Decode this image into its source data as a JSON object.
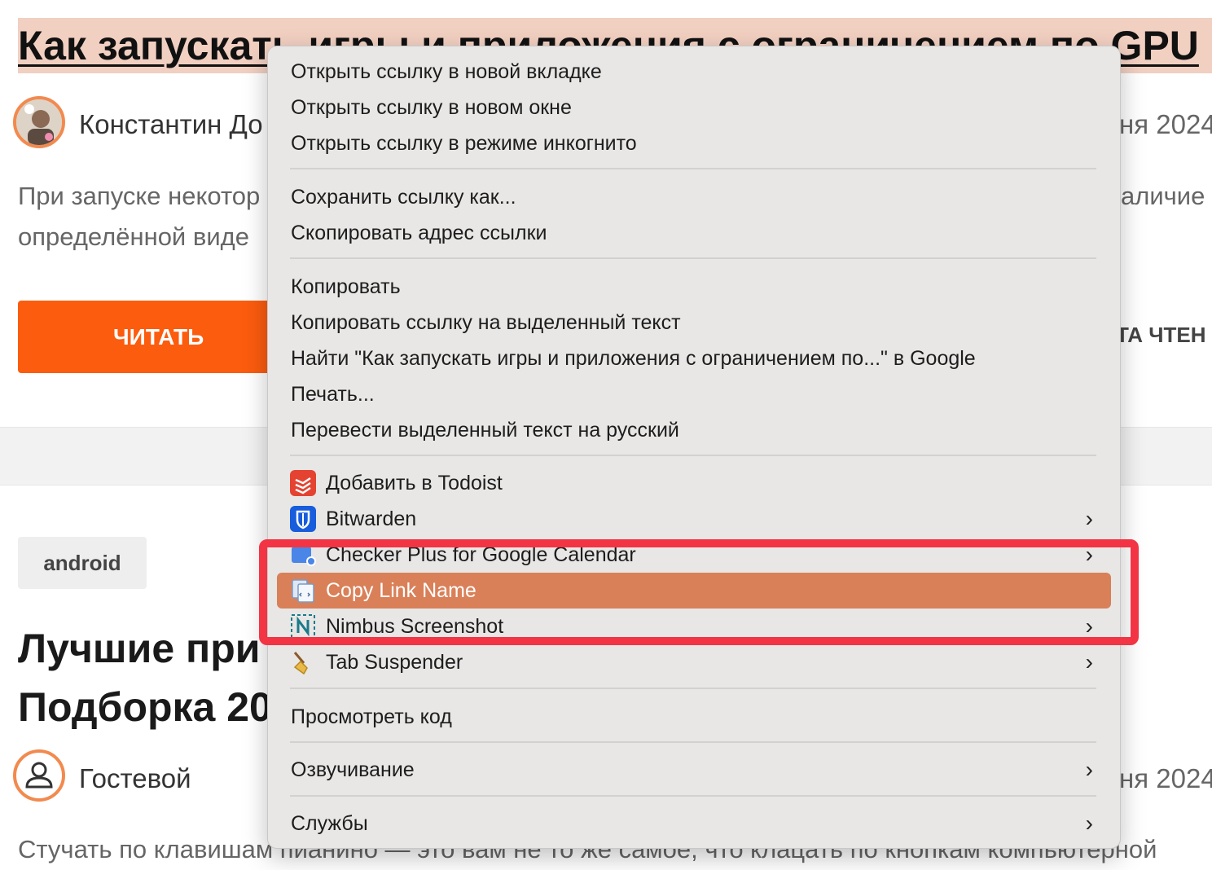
{
  "article1": {
    "title": "Как запускать игры и приложения с ограничением по GPU",
    "author": "Константин До",
    "date_tail": "ня 2024",
    "excerpt_line1_left": "При запуске некотор",
    "excerpt_line1_right": "аличие",
    "excerpt_line2_left": "определённой виде",
    "read_button": "ЧИТАТЬ",
    "readtime_tail": "ТА ЧТЕН"
  },
  "article2": {
    "tag": "android",
    "title_line1": "Лучшие при",
    "title_line2": "Подборка 20",
    "author": "Гостевой",
    "date_tail": "ня 2024",
    "excerpt": "Стучать по клавишам пианино — это вам не то же самое, что клацать по кнопкам компьютерной"
  },
  "context_menu": {
    "items": [
      {
        "label": "Открыть ссылку в новой вкладке"
      },
      {
        "label": "Открыть ссылку в новом окне"
      },
      {
        "label": "Открыть ссылку в режиме инкогнито"
      },
      {
        "label": "Сохранить ссылку как..."
      },
      {
        "label": "Скопировать адрес ссылки"
      },
      {
        "label": "Копировать"
      },
      {
        "label": "Копировать ссылку на выделенный текст"
      },
      {
        "label": "Найти \"Как запускать игры и приложения с ограничением по...\" в Google"
      },
      {
        "label": "Печать..."
      },
      {
        "label": "Перевести выделенный текст на русский"
      },
      {
        "label": "Добавить в Todoist",
        "icon": "todoist-icon"
      },
      {
        "label": "Bitwarden",
        "icon": "bitwarden-icon",
        "submenu": true
      },
      {
        "label": "Checker Plus for Google Calendar",
        "icon": "calendar-checker-icon",
        "submenu": true
      },
      {
        "label": "Copy Link Name",
        "icon": "copy-link-name-icon",
        "highlighted": true
      },
      {
        "label": "Nimbus Screenshot",
        "icon": "nimbus-icon",
        "submenu": true
      },
      {
        "label": "Tab Suspender",
        "icon": "broom-icon",
        "submenu": true
      },
      {
        "label": "Просмотреть код"
      },
      {
        "label": "Озвучивание",
        "submenu": true
      },
      {
        "label": "Службы",
        "submenu": true
      }
    ],
    "submenu_glyph": "›"
  },
  "colors": {
    "accent": "#fc5c0e",
    "highlight": "#d98059",
    "annotation": "#f23444"
  }
}
